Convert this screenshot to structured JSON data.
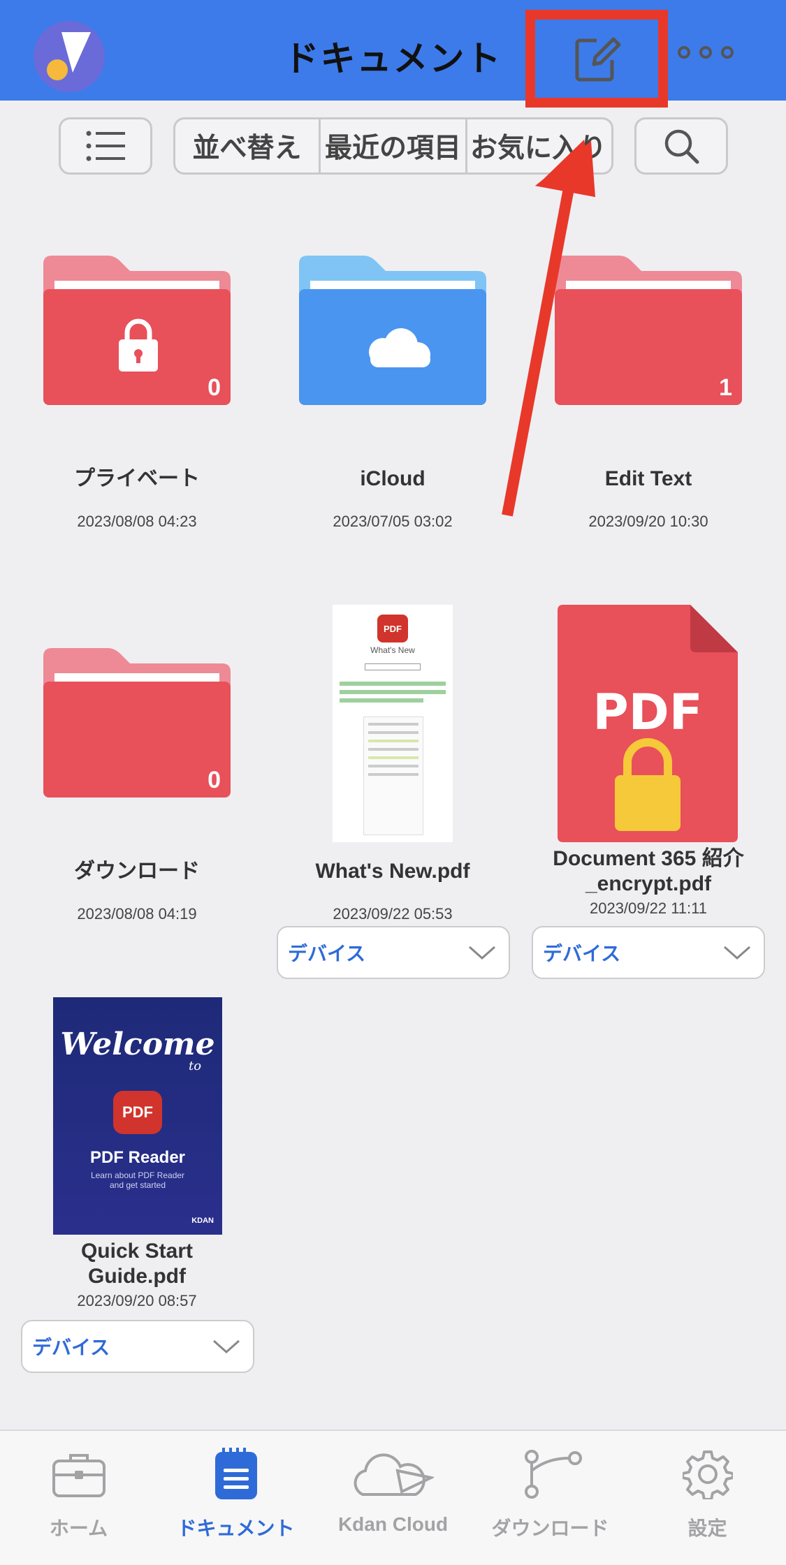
{
  "header": {
    "title": "ドキュメント"
  },
  "toolbar": {
    "segments": [
      "並べ替え",
      "最近の項目",
      "お気に入り"
    ]
  },
  "items": [
    {
      "type": "folder",
      "name": "プライベート",
      "date": "2023/08/08 04:23",
      "count": "0",
      "color": "#e8505a",
      "icon": "lock-icon"
    },
    {
      "type": "folder",
      "name": "iCloud",
      "date": "2023/07/05 03:02",
      "count": "",
      "color": "#4a95ef",
      "icon": "cloud-icon"
    },
    {
      "type": "folder",
      "name": "Edit Text",
      "date": "2023/09/20 10:30",
      "count": "1",
      "color": "#e8505a",
      "icon": ""
    },
    {
      "type": "folder",
      "name": "ダウンロード",
      "date": "2023/08/08 04:19",
      "count": "0",
      "color": "#e8505a",
      "icon": ""
    },
    {
      "type": "file",
      "name": "What's New.pdf",
      "date": "2023/09/22 05:53",
      "location": "デバイス",
      "thumb_badge": "PDF",
      "thumb_title": "What's New"
    },
    {
      "type": "file",
      "name": "Document 365 紹介_encrypt.pdf",
      "date": "2023/09/22 11:11",
      "location": "デバイス",
      "thumb_badge": "PDF"
    },
    {
      "type": "file",
      "name": "Quick Start Guide.pdf",
      "date": "2023/09/20 08:57",
      "location": "デバイス",
      "thumb_badge": "PDF",
      "thumb_welcome": "Welcome",
      "thumb_to": "to",
      "thumb_title": "PDF Reader",
      "thumb_sub": "Learn about PDF Reader and get started",
      "thumb_brand": "KDAN"
    }
  ],
  "tabbar": {
    "tabs": [
      {
        "label": "ホーム",
        "icon": "briefcase-icon",
        "active": false
      },
      {
        "label": "ドキュメント",
        "icon": "document-icon",
        "active": true
      },
      {
        "label": "Kdan Cloud",
        "icon": "kdan-cloud-icon",
        "active": false
      },
      {
        "label": "ダウンロード",
        "icon": "download-icon",
        "active": false
      },
      {
        "label": "設定",
        "icon": "gear-icon",
        "active": false
      }
    ]
  },
  "colors": {
    "header": "#3d7bea",
    "highlight": "#e8382a",
    "active_tab": "#2f6bd8",
    "folder_red": "#e8505a",
    "folder_blue": "#4a95ef"
  }
}
